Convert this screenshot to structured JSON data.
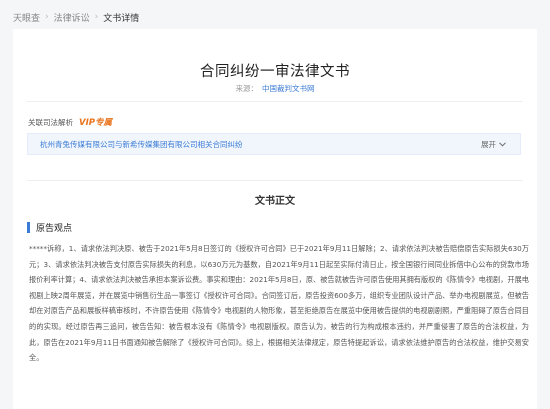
{
  "breadcrumb": [
    "天眼查",
    "法律诉讼",
    "文书详情"
  ],
  "document": {
    "title": "合同纠纷一审法律文书",
    "source_label": "来源：",
    "source_value": "中国裁判文书网"
  },
  "related": {
    "label": "关联司法解析",
    "vip_badge": "VIP专属",
    "case_title": "杭州青兔传媒有限公司与新希传媒集团有限公司相关合同纠纷",
    "expand_label": "展开"
  },
  "section": {
    "title": "文书正文",
    "subsection_title": "原告观点",
    "paragraph": "*****诉称，1、请求依法判决原、被告于2021年5月8日签订的《授权许可合同》已于2021年9月11日解除；2、请求依法判决被告赔偿原告实际损失630万元；3、请求依法判决被告支付原告实际损失的利息，以630万元为基数，自2021年9月11日起至实际付清日止，按全国银行间同业拆借中心公布的贷款市场报价利率计算；4、请求依法判决被告承担本案诉讼费。事实和理由：2021年5月8日，原、被告就被告许可原告使用其拥有版权的《陈情令》电视剧，开展电视剧上映2周年展览，并在展览中销售衍生品一事签订《授权许可合同》。合同签订后，原告投资600多万，组织专业团队设计产品、举办电视剧展览，但被告却在对原告产品和展板样稿审核时，不许原告使用《陈情令》电视剧的人物形象，甚至拒绝原告在展览中使用被告提供的电视剧剧照，严重阻碍了原告合同目的的实现。经过原告再三追问，被告告知：被告根本没有《陈情令》电视剧版权。原告认为，被告的行为构成根本违约，并严重侵害了原告的合法权益，为此，原告在2021年9月11日书面通知被告解除了《授权许可合同》。综上，根据相关法律规定，原告特提起诉讼，请求依法维护原告的合法权益，维护交易安全。"
  }
}
